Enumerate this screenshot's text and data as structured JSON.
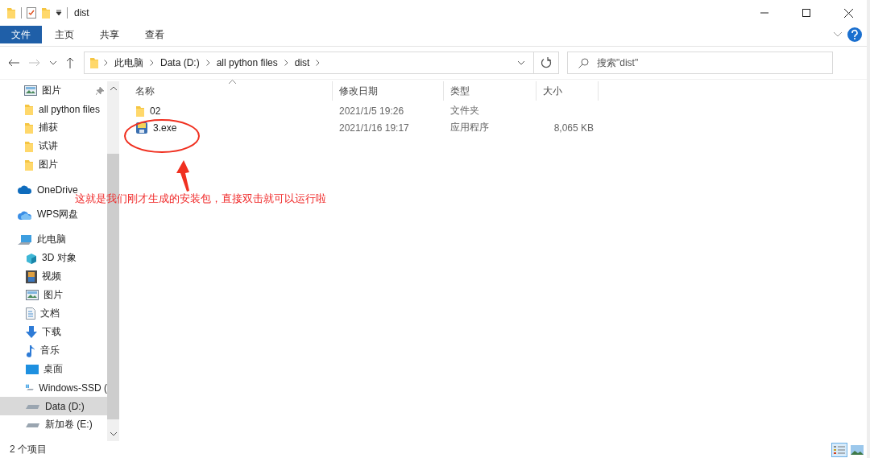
{
  "window": {
    "title": "dist"
  },
  "ribbon_tabs": [
    {
      "label": "文件",
      "selected": true
    },
    {
      "label": "主页",
      "selected": false
    },
    {
      "label": "共享",
      "selected": false
    },
    {
      "label": "查看",
      "selected": false
    }
  ],
  "address": {
    "crumbs": [
      "此电脑",
      "Data (D:)",
      "all python files",
      "dist"
    ]
  },
  "search": {
    "placeholder": "搜索\"dist\""
  },
  "sidebar": {
    "quick_access": [
      {
        "label": "图片",
        "kind": "pictures",
        "pinned": true
      },
      {
        "label": "all python files",
        "kind": "folder",
        "pinned": false
      },
      {
        "label": "捕获",
        "kind": "folder",
        "pinned": false
      },
      {
        "label": "试讲",
        "kind": "folder",
        "pinned": false
      },
      {
        "label": "图片",
        "kind": "folder",
        "pinned": false
      }
    ],
    "items": [
      {
        "label": "OneDrive",
        "kind": "onedrive",
        "selected": false
      },
      {
        "label": "WPS网盘",
        "kind": "wps",
        "selected": false
      },
      {
        "label": "此电脑",
        "kind": "pc",
        "selected": false,
        "children": [
          {
            "label": "3D 对象",
            "kind": "cube",
            "selected": false
          },
          {
            "label": "视频",
            "kind": "video",
            "selected": false
          },
          {
            "label": "图片",
            "kind": "pictures",
            "selected": false
          },
          {
            "label": "文档",
            "kind": "docs",
            "selected": false
          },
          {
            "label": "下载",
            "kind": "download",
            "selected": false
          },
          {
            "label": "音乐",
            "kind": "music",
            "selected": false
          },
          {
            "label": "桌面",
            "kind": "desktop",
            "selected": false
          },
          {
            "label": "Windows-SSD (",
            "kind": "windrive",
            "selected": false
          },
          {
            "label": "Data (D:)",
            "kind": "drive",
            "selected": true
          },
          {
            "label": "新加卷 (E:)",
            "kind": "drive",
            "selected": false
          }
        ]
      }
    ]
  },
  "table": {
    "columns": [
      "名称",
      "修改日期",
      "类型",
      "大小"
    ],
    "rows": [
      {
        "kind": "folder",
        "name": "02",
        "date": "2021/1/5 19:26",
        "type": "文件夹"
      },
      {
        "kind": "exe",
        "name": "3.exe",
        "date": "2021/1/16 19:17",
        "type": "应用程序",
        "size": "8,065 KB"
      }
    ]
  },
  "annotation": {
    "text": "这就是我们刚才生成的安装包，直接双击就可以运行啦"
  },
  "status_bar": {
    "count": "2 个项目",
    "views": [
      {
        "kind": "details",
        "selected": true
      },
      {
        "kind": "preview",
        "selected": false
      }
    ]
  }
}
